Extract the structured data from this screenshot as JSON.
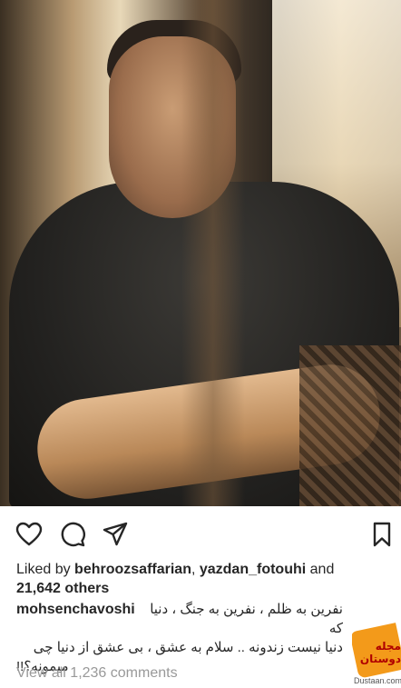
{
  "post": {
    "photo_alt": "photo",
    "likes": {
      "prefix": "Liked by ",
      "user1": "behroozsaffarian",
      "separator": ", ",
      "user2": "yazdan_fotouhi",
      "and": " and",
      "count": "21,642 others"
    },
    "caption": {
      "owner": "mohsenchavoshi",
      "line1": "نفرین به ظلم ، نفرین به جنگ ، دنیا  که",
      "line2": "دنیا نیست زندونه .. سلام به عشق ، بی عشق از دنیا چی",
      "line3": "میمونه؟!!"
    },
    "view_all": "View all 1,236 comments"
  },
  "watermark": {
    "badge": "مجله دوستان",
    "site": "Dustaan.com"
  },
  "icons": {
    "like": "heart-icon",
    "comment": "comment-bubble-icon",
    "share": "paper-plane-icon",
    "save": "bookmark-icon"
  }
}
